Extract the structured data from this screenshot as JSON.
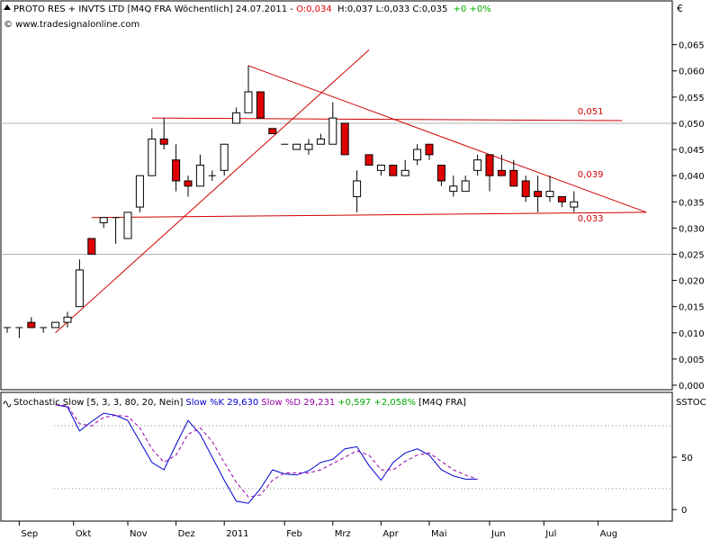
{
  "header": {
    "title": "PROTO RES + INVTS LTD [M4Q FRA  Wöchentlich] 24.07.2011 -",
    "o": "O:0,034",
    "hlc": "H:0,037 L:0,033 C:0,035",
    "chg": "+0 +0%",
    "currency": "€",
    "watermark": "© www.tradesignalonline.com"
  },
  "colors": {
    "up": "#ffffff",
    "down": "#e00000",
    "line": "#d00000",
    "k": "#0000cc",
    "d": "#9900aa",
    "grid": "#e0e0e0"
  },
  "chart_data": [
    {
      "type": "candlestick",
      "title": "PROTO RES + INVTS LTD [M4Q FRA  Wöchentlich] 24.07.2011",
      "ylim": [
        0,
        0.067
      ],
      "yticks": [
        "0,000",
        "0,005",
        "0,010",
        "0,015",
        "0,020",
        "0,025",
        "0,030",
        "0,035",
        "0,040",
        "0,045",
        "0,050",
        "0,055",
        "0,060",
        "0,065"
      ],
      "xlabels": [
        {
          "label": "Sep",
          "i": 1
        },
        {
          "label": "Okt",
          "i": 5.5
        },
        {
          "label": "Nov",
          "i": 10
        },
        {
          "label": "Dez",
          "i": 14
        },
        {
          "label": "2011",
          "i": 18
        },
        {
          "label": "Feb",
          "i": 23
        },
        {
          "label": "Mrz",
          "i": 27
        },
        {
          "label": "Apr",
          "i": 31
        },
        {
          "label": "Mai",
          "i": 35
        },
        {
          "label": "Jun",
          "i": 40
        },
        {
          "label": "Jul",
          "i": 44.5
        },
        {
          "label": "Aug",
          "i": 49
        }
      ],
      "candles": [
        [
          0.011,
          0.011,
          0.01,
          0.011
        ],
        [
          0.011,
          0.011,
          0.009,
          0.011
        ],
        [
          0.012,
          0.013,
          0.011,
          0.011
        ],
        [
          0.011,
          0.011,
          0.01,
          0.011
        ],
        [
          0.011,
          0.012,
          0.011,
          0.012
        ],
        [
          0.012,
          0.014,
          0.011,
          0.013
        ],
        [
          0.015,
          0.024,
          0.015,
          0.022
        ],
        [
          0.028,
          0.028,
          0.026,
          0.025
        ],
        [
          0.031,
          0.032,
          0.03,
          0.032
        ],
        [
          0.032,
          0.032,
          0.027,
          0.032
        ],
        [
          0.028,
          0.033,
          0.028,
          0.033
        ],
        [
          0.034,
          0.04,
          0.033,
          0.04
        ],
        [
          0.04,
          0.049,
          0.04,
          0.047
        ],
        [
          0.047,
          0.051,
          0.045,
          0.046
        ],
        [
          0.043,
          0.046,
          0.037,
          0.039
        ],
        [
          0.039,
          0.04,
          0.036,
          0.038
        ],
        [
          0.038,
          0.044,
          0.038,
          0.042
        ],
        [
          0.04,
          0.041,
          0.039,
          0.04
        ],
        [
          0.041,
          0.046,
          0.04,
          0.046
        ],
        [
          0.05,
          0.053,
          0.05,
          0.052
        ],
        [
          0.052,
          0.061,
          0.052,
          0.056
        ],
        [
          0.056,
          0.056,
          0.051,
          0.051
        ],
        [
          0.049,
          0.049,
          0.048,
          0.048
        ],
        [
          0.046,
          0.046,
          0.046,
          0.046
        ],
        [
          0.045,
          0.046,
          0.045,
          0.046
        ],
        [
          0.045,
          0.047,
          0.044,
          0.046
        ],
        [
          0.046,
          0.048,
          0.046,
          0.047
        ],
        [
          0.046,
          0.054,
          0.046,
          0.051
        ],
        [
          0.05,
          0.05,
          0.044,
          0.044
        ],
        [
          0.036,
          0.041,
          0.033,
          0.039
        ],
        [
          0.044,
          0.044,
          0.042,
          0.042
        ],
        [
          0.041,
          0.042,
          0.04,
          0.042
        ],
        [
          0.042,
          0.042,
          0.04,
          0.04
        ],
        [
          0.04,
          0.043,
          0.04,
          0.041
        ],
        [
          0.043,
          0.046,
          0.042,
          0.045
        ],
        [
          0.046,
          0.046,
          0.043,
          0.044
        ],
        [
          0.042,
          0.042,
          0.038,
          0.039
        ],
        [
          0.037,
          0.04,
          0.036,
          0.038
        ],
        [
          0.037,
          0.04,
          0.037,
          0.039
        ],
        [
          0.041,
          0.044,
          0.04,
          0.043
        ],
        [
          0.044,
          0.044,
          0.037,
          0.04
        ],
        [
          0.041,
          0.044,
          0.04,
          0.04
        ],
        [
          0.041,
          0.043,
          0.039,
          0.038
        ],
        [
          0.039,
          0.04,
          0.035,
          0.036
        ],
        [
          0.037,
          0.04,
          0.033,
          0.036
        ],
        [
          0.036,
          0.04,
          0.035,
          0.037
        ],
        [
          0.036,
          0.036,
          0.034,
          0.035
        ],
        [
          0.034,
          0.037,
          0.033,
          0.035
        ]
      ],
      "lines": [
        {
          "name": "trend-up",
          "from": [
            4,
            0.01
          ],
          "to": [
            30,
            0.064
          ]
        },
        {
          "name": "trend-down",
          "from": [
            20,
            0.061
          ],
          "to": [
            53,
            0.033
          ]
        },
        {
          "name": "support",
          "from": [
            7,
            0.032
          ],
          "to": [
            53,
            0.033
          ]
        },
        {
          "name": "resistance",
          "from": [
            12,
            0.051
          ],
          "to": [
            51,
            0.0505
          ]
        }
      ],
      "level_labels": [
        {
          "text": "0,051",
          "i": 47,
          "v": 0.051
        },
        {
          "text": "0,039",
          "i": 47,
          "v": 0.039
        },
        {
          "text": "0,033",
          "i": 47,
          "v": 0.033
        }
      ],
      "hgrid": [
        0.025,
        0.05
      ]
    },
    {
      "type": "line",
      "title": "Stochastic Slow [5, 3, 3, 80, 20, Nein]",
      "legend": [
        {
          "text": "Stochastic Slow [5, 3, 3, 80, 20, Nein]",
          "color": "#000000"
        },
        {
          "text": "Slow %K 29,630",
          "color": "#0000cc"
        },
        {
          "text": "Slow %D 29,231",
          "color": "#9900aa"
        },
        {
          "text": "+0,597 +2,058%",
          "color": "#00aa00"
        },
        {
          "text": "[M4Q FRA]",
          "color": "#000000"
        }
      ],
      "panel_label": "SSTOC",
      "ylim": [
        -5,
        105
      ],
      "yticks": [
        "0",
        "50"
      ],
      "x_start": 4,
      "series": [
        {
          "name": "Slow %K",
          "color": "#0000cc",
          "dashed": false,
          "values": [
            100,
            98,
            75,
            84,
            92,
            90,
            85,
            65,
            45,
            38,
            62,
            85,
            72,
            50,
            28,
            8,
            6,
            20,
            38,
            34,
            33,
            37,
            45,
            48,
            58,
            60,
            42,
            28,
            45,
            54,
            58,
            52,
            38,
            32,
            29,
            29
          ]
        },
        {
          "name": "Slow %D",
          "color": "#9900aa",
          "dashed": true,
          "values": [
            100,
            99,
            82,
            80,
            88,
            90,
            89,
            78,
            58,
            45,
            52,
            72,
            78,
            65,
            45,
            26,
            12,
            14,
            28,
            35,
            35,
            35,
            38,
            44,
            50,
            56,
            52,
            38,
            38,
            46,
            52,
            54,
            46,
            38,
            33,
            29
          ]
        }
      ],
      "hgrid": [
        20,
        80
      ]
    }
  ]
}
